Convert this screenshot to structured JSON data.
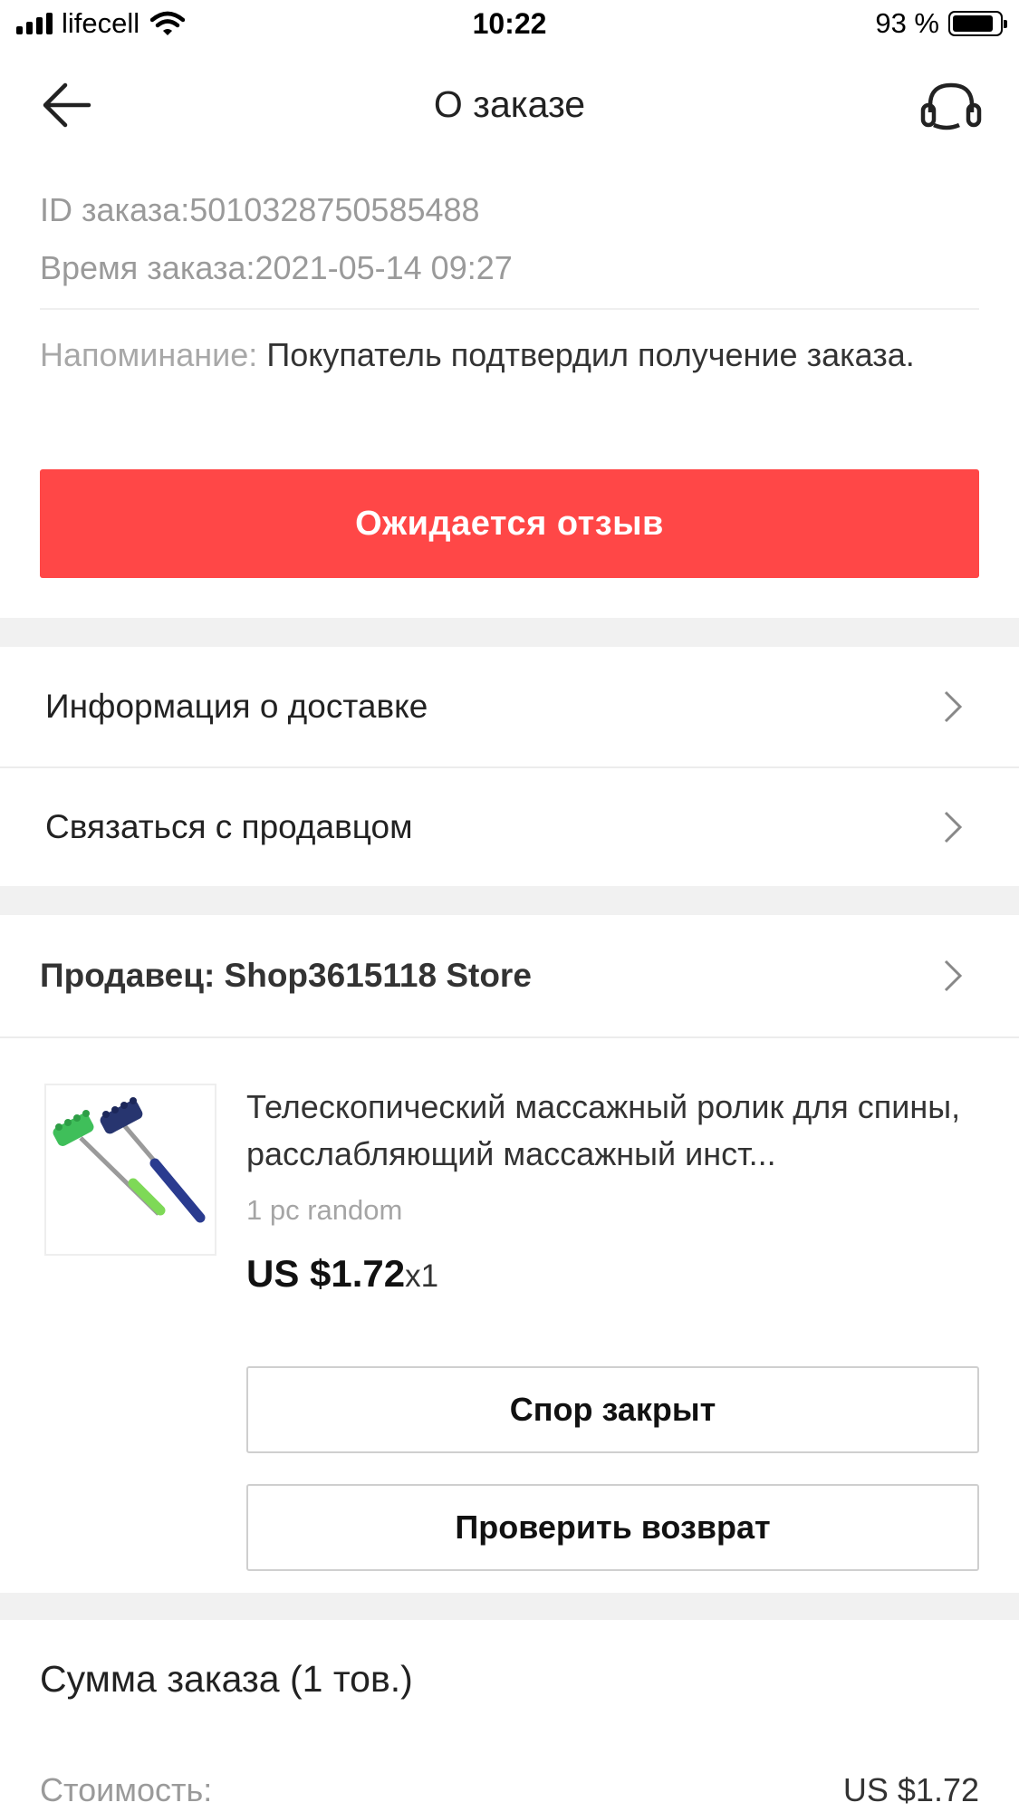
{
  "status_bar": {
    "carrier": "lifecell",
    "time": "10:22",
    "battery": "93 %"
  },
  "header": {
    "title": "О заказе",
    "back_icon": "arrow-left-icon",
    "support_icon": "headset-icon"
  },
  "order": {
    "id_line": "ID заказа:5010328750585488",
    "time_line": "Время заказа:2021-05-14 09:27",
    "reminder_label": "Напоминание: ",
    "reminder_text": "Покупатель подтвердил получение заказа."
  },
  "review_button": "Ожидается отзыв",
  "links": {
    "delivery_info": "Информация о доставке",
    "contact_seller": "Связаться с продавцом"
  },
  "seller": {
    "label": "Продавец: Shop3615118 Store"
  },
  "product": {
    "title": "Телескопический массажный ролик для спины, расслабляющий массажный инст...",
    "variant": "1 pc random",
    "price": "US $1.72",
    "qty": "x1",
    "image_icon": "massage-roller-image"
  },
  "actions": {
    "dispute_closed": "Спор закрыт",
    "check_return": "Проверить возврат"
  },
  "summary": {
    "title": "Сумма заказа (1 тов.)",
    "cost_label": "Стоимость:",
    "cost_value": "US $1.72"
  },
  "colors": {
    "accent": "#ff4747",
    "section_gap": "#f1f1f1"
  }
}
